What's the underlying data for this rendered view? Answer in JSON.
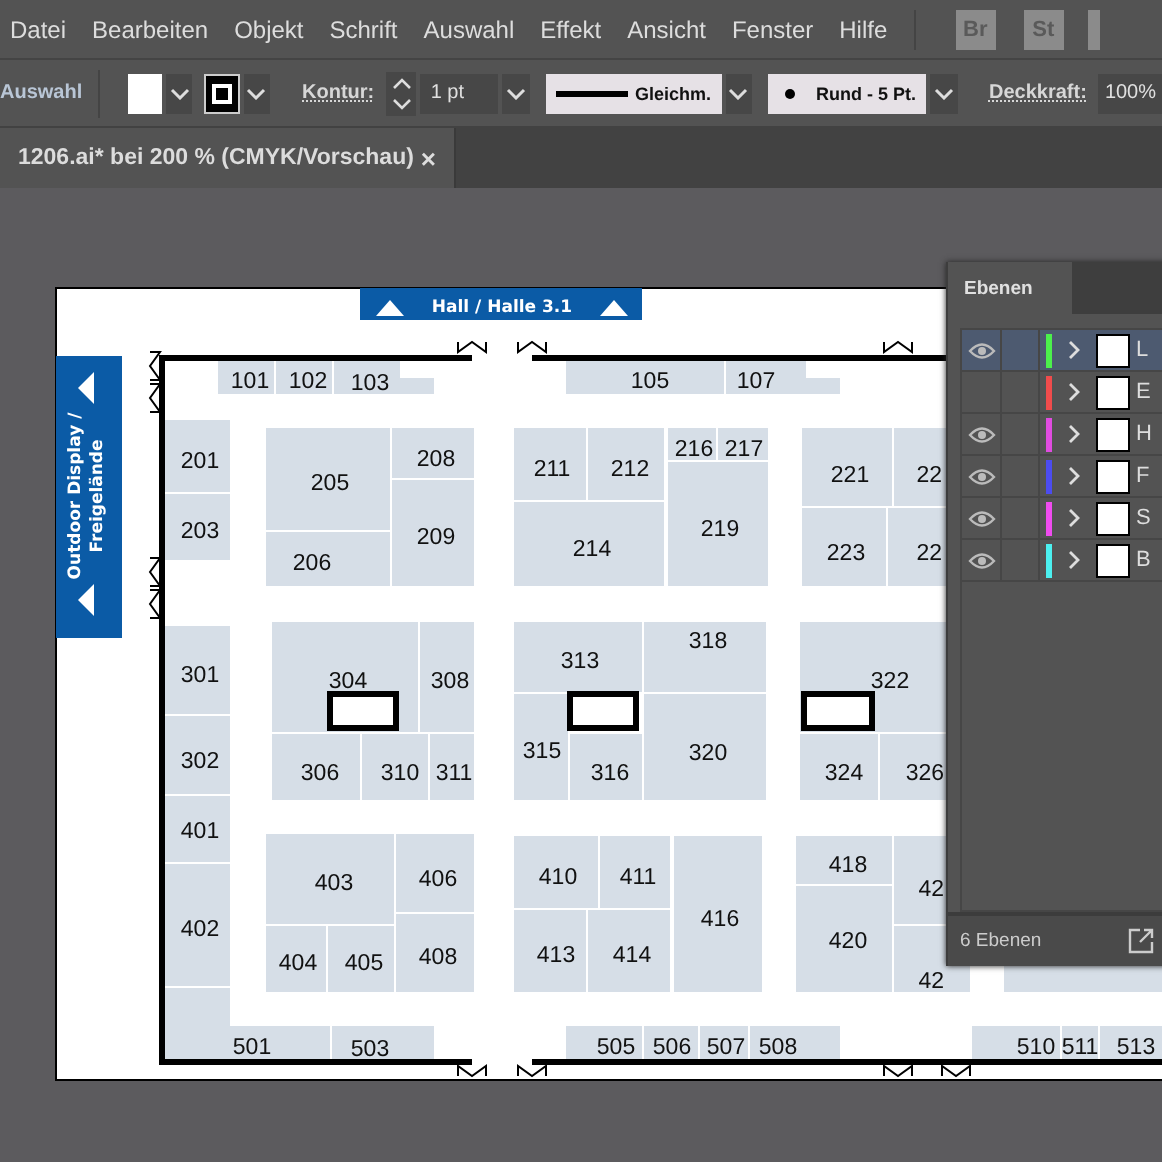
{
  "menu_bar": {
    "items": [
      "Datei",
      "Bearbeiten",
      "Objekt",
      "Schrift",
      "Auswahl",
      "Effekt",
      "Ansicht",
      "Fenster",
      "Hilfe"
    ],
    "app_icons": [
      "Br",
      "St"
    ]
  },
  "control_bar": {
    "mode_label": "Auswahl",
    "stroke_label": "Kontur:",
    "stroke_weight": "1 pt",
    "stroke_profile": "Gleichm.",
    "brush": "Rund - 5 Pt.",
    "opacity_label": "Deckkraft:",
    "opacity": "100%"
  },
  "document_tab": {
    "title": "1206.ai* bei 200 % (CMYK/Vorschau)",
    "close": "×"
  },
  "floor_plan": {
    "hall_sign": "Hall / Halle 3.1",
    "outdoor_sign": [
      "Outdoor Display /",
      "Freigelände"
    ],
    "booths": [
      {
        "number": "101"
      },
      {
        "number": "102"
      },
      {
        "number": "103"
      },
      {
        "number": "105"
      },
      {
        "number": "107"
      },
      {
        "number": "201"
      },
      {
        "number": "203"
      },
      {
        "number": "205"
      },
      {
        "number": "206"
      },
      {
        "number": "208"
      },
      {
        "number": "209"
      },
      {
        "number": "211"
      },
      {
        "number": "212"
      },
      {
        "number": "214"
      },
      {
        "number": "216"
      },
      {
        "number": "217"
      },
      {
        "number": "219"
      },
      {
        "number": "221"
      },
      {
        "number": "22"
      },
      {
        "number": "223"
      },
      {
        "number": "22"
      },
      {
        "number": "301"
      },
      {
        "number": "302"
      },
      {
        "number": "401"
      },
      {
        "number": "402"
      },
      {
        "number": "304"
      },
      {
        "number": "308"
      },
      {
        "number": "306"
      },
      {
        "number": "310"
      },
      {
        "number": "311"
      },
      {
        "number": "313"
      },
      {
        "number": "318"
      },
      {
        "number": "315"
      },
      {
        "number": "316"
      },
      {
        "number": "320"
      },
      {
        "number": "322"
      },
      {
        "number": "324"
      },
      {
        "number": "326"
      },
      {
        "number": "403"
      },
      {
        "number": "406"
      },
      {
        "number": "404"
      },
      {
        "number": "405"
      },
      {
        "number": "408"
      },
      {
        "number": "410"
      },
      {
        "number": "411"
      },
      {
        "number": "413"
      },
      {
        "number": "414"
      },
      {
        "number": "416"
      },
      {
        "number": "418"
      },
      {
        "number": "420"
      },
      {
        "number": "42"
      },
      {
        "number": "42"
      },
      {
        "number": "501"
      },
      {
        "number": "503"
      },
      {
        "number": "505"
      },
      {
        "number": "506"
      },
      {
        "number": "507"
      },
      {
        "number": "508"
      },
      {
        "number": "510"
      },
      {
        "number": "511"
      },
      {
        "number": "513"
      }
    ]
  },
  "layers_panel": {
    "tab": "Ebenen",
    "layers": [
      {
        "name": "L",
        "visible": true,
        "selected": true,
        "color": "#4cf04c"
      },
      {
        "name": "E",
        "visible": false,
        "selected": false,
        "color": "#f04c4c"
      },
      {
        "name": "H",
        "visible": true,
        "selected": false,
        "color": "#e04ce0"
      },
      {
        "name": "F",
        "visible": true,
        "selected": false,
        "color": "#4c4cf0"
      },
      {
        "name": "S",
        "visible": true,
        "selected": false,
        "color": "#f04cf0"
      },
      {
        "name": "B",
        "visible": true,
        "selected": false,
        "color": "#4cf0f0"
      }
    ],
    "footer": "6 Ebenen"
  }
}
